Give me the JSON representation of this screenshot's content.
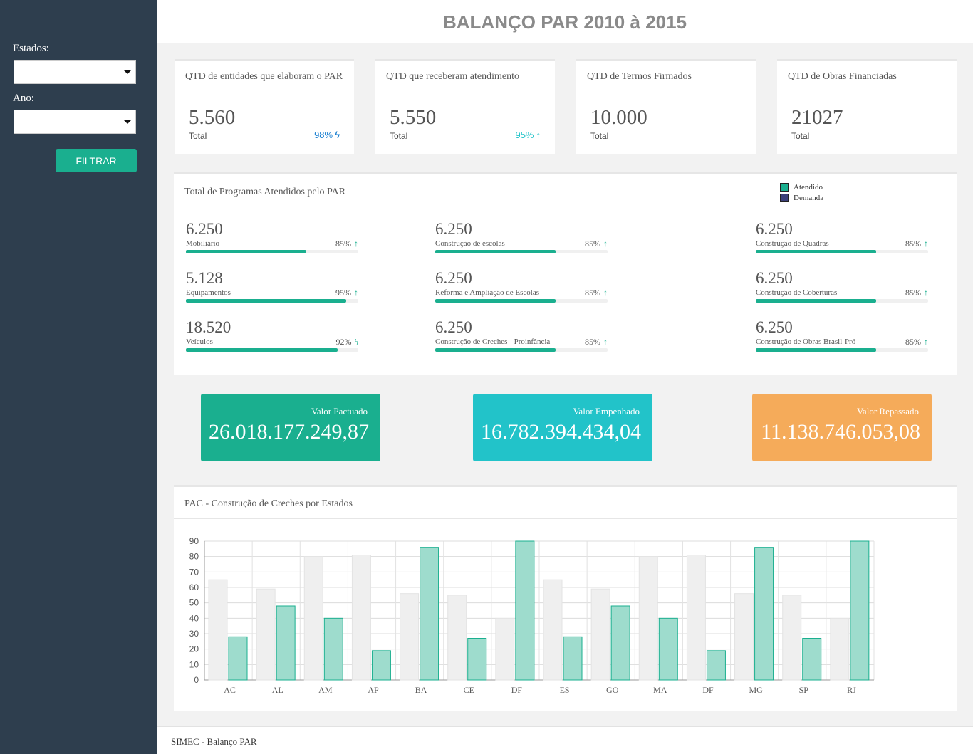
{
  "sidebar": {
    "estados_label": "Estados:",
    "ano_label": "Ano:",
    "filter_button": "FILTRAR"
  },
  "header": {
    "title": "BALANÇO PAR 2010 à 2015"
  },
  "kpis": [
    {
      "title": "QTD de entidades que elaboram o PAR",
      "value": "5.560",
      "sub": "Total",
      "pct": "98%",
      "pct_icon": "bolt-icon",
      "pct_color": "#1a7fd0"
    },
    {
      "title": "QTD que receberam atendimento",
      "value": "5.550",
      "sub": "Total",
      "pct": "95%",
      "pct_icon": "arrow-up-icon",
      "pct_color": "#22c3c9"
    },
    {
      "title": "QTD de Termos Firmados",
      "value": "10.000",
      "sub": "Total"
    },
    {
      "title": "QTD de Obras Financiadas",
      "value": "21027",
      "sub": "Total"
    }
  ],
  "programs": {
    "title": "Total de Programas Atendidos pelo PAR",
    "legend": [
      {
        "label": "Atendido",
        "color": "#1aaf8f"
      },
      {
        "label": "Demanda",
        "color": "#3b3f7a"
      }
    ],
    "items": [
      {
        "value": "6.250",
        "name": "Mobiliário",
        "pct": "85%",
        "progress": 0.7,
        "icon": "arrow-up-icon"
      },
      {
        "value": "5.128",
        "name": "Equipamentos",
        "pct": "95%",
        "progress": 0.93,
        "icon": "arrow-up-icon"
      },
      {
        "value": "18.520",
        "name": "Veículos",
        "pct": "92%",
        "progress": 0.88,
        "icon": "bolt-icon"
      },
      {
        "value": "6.250",
        "name": "Construção de escolas",
        "pct": "85%",
        "progress": 0.7,
        "icon": "arrow-up-icon"
      },
      {
        "value": "6.250",
        "name": "Reforma e Ampliação de Escolas",
        "pct": "85%",
        "progress": 0.7,
        "icon": "arrow-up-icon"
      },
      {
        "value": "6.250",
        "name": "Construção de Creches - Proinfância",
        "pct": "85%",
        "progress": 0.7,
        "icon": "arrow-up-icon"
      },
      {
        "value": "6.250",
        "name": "Construção de Quadras",
        "pct": "85%",
        "progress": 0.7,
        "icon": "arrow-up-icon"
      },
      {
        "value": "6.250",
        "name": "Construção de Coberturas",
        "pct": "85%",
        "progress": 0.7,
        "icon": "arrow-up-icon"
      },
      {
        "value": "6.250",
        "name": "Construção de Obras Brasil-Pró",
        "pct": "85%",
        "progress": 0.7,
        "icon": "arrow-up-icon"
      }
    ]
  },
  "values": [
    {
      "label": "Valor Pactuado",
      "value": "26.018.177.249,87",
      "color": "#1aaf8f"
    },
    {
      "label": "Valor Empenhado",
      "value": "16.782.394.434,04",
      "color": "#22c3c9"
    },
    {
      "label": "Valor Repassado",
      "value": "11.138.746.053,08",
      "color": "#f5ab5a"
    }
  ],
  "chart_title": "PAC - Construção de Creches por Estados",
  "chart_data": {
    "type": "bar",
    "categories": [
      "AC",
      "AL",
      "AM",
      "AP",
      "BA",
      "CE",
      "DF",
      "ES",
      "GO",
      "MA",
      "DF",
      "MG",
      "SP",
      "RJ"
    ],
    "series": [
      {
        "values": [
          65,
          59,
          80,
          81,
          56,
          55,
          40,
          65,
          59,
          80,
          81,
          56,
          55,
          40
        ],
        "color": "#efefef"
      },
      {
        "values": [
          28,
          48,
          40,
          19,
          86,
          27,
          90,
          28,
          48,
          40,
          19,
          86,
          27,
          90
        ],
        "color": "#9edccd"
      }
    ],
    "ylim": [
      0,
      90
    ],
    "yticks": [
      0,
      10,
      20,
      30,
      40,
      50,
      60,
      70,
      80,
      90
    ],
    "grid": true
  },
  "footer": {
    "text": "SIMEC - Balanço PAR"
  }
}
